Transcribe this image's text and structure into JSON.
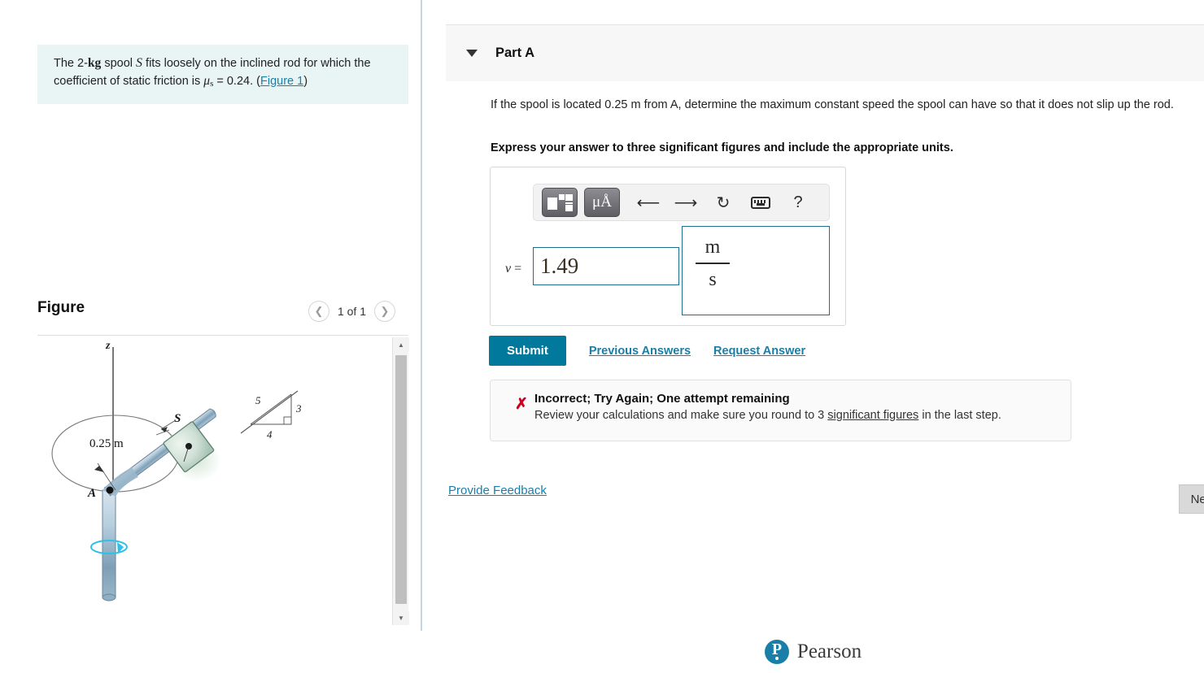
{
  "left": {
    "problem": {
      "pre_mass": "The 2-",
      "mass_unit": "kg",
      "mid1": " spool ",
      "body_symbol": "S",
      "mid2": " fits loosely on the inclined rod for which the coefficient of static friction is ",
      "mu_symbol": "μ",
      "mu_sub": "s",
      "mu_value": " = 0.24. (",
      "figure_link": "Figure 1",
      "close": ")"
    },
    "figure": {
      "title": "Figure",
      "prev_icon": "chevron-left-icon",
      "count": "1 of 1",
      "next_icon": "chevron-right-icon",
      "diagram": {
        "axis_label": "z",
        "point_a": "A",
        "spool_label": "S",
        "dimension": "0.25 m",
        "slope_hyp": "5",
        "slope_vert": "3",
        "slope_horiz": "4"
      }
    }
  },
  "right": {
    "part": {
      "caret_icon": "caret-down-icon",
      "label": "Part A"
    },
    "question": "If the spool is located 0.25 m from A, determine the maximum constant speed the spool can have so that it does not slip up the rod.",
    "question_unit": "m",
    "instruction": "Express your answer to three significant figures and include the appropriate units.",
    "toolbar": {
      "template_icon": "math-template-icon",
      "units_label": "μÅ",
      "undo_icon": "undo-arrow-icon",
      "redo_icon": "redo-arrow-icon",
      "reset_icon": "reset-circular-arrow-icon",
      "keyboard_icon": "keyboard-icon",
      "help_label": "?"
    },
    "answer": {
      "variable": "v",
      "equals": "=",
      "value": "1.49",
      "unit_numerator": "m",
      "unit_denominator": "s"
    },
    "actions": {
      "submit_label": "Submit",
      "previous_answers_label": "Previous Answers",
      "request_answer_label": "Request Answer"
    },
    "feedback": {
      "status_icon": "error-x-icon",
      "title": "Incorrect; Try Again; One attempt remaining",
      "body_pre": "Review your calculations and make sure you round to 3 ",
      "body_link": "significant figures",
      "body_post": " in the last step."
    },
    "provide_feedback_label": "Provide Feedback",
    "next_label": "Next"
  },
  "footer": {
    "logo_icon": "pearson-logo-icon",
    "logo_letter": "P",
    "brand": "Pearson"
  },
  "colors": {
    "accent_teal": "#00799c",
    "link_blue": "#1a7fa8",
    "error_red": "#cc0022",
    "problem_bg": "#e9f4f4",
    "divider": "#c3d3e0"
  }
}
